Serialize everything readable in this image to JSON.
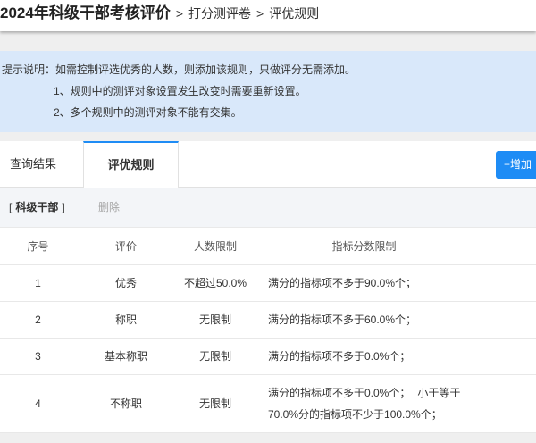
{
  "header": {
    "title": "2024年科级干部考核评价",
    "separator": ">",
    "breadcrumb": [
      "打分测评卷",
      "评优规则"
    ]
  },
  "notice": {
    "lines": [
      "提示说明：如需控制评选优秀的人数，则添加该规则，只做评分无需添加。",
      "1、规则中的测评对象设置发生改变时需要重新设置。",
      "2、多个规则中的测评对象不能有交集。"
    ]
  },
  "tabs": [
    {
      "label": "查询结果",
      "active": false
    },
    {
      "label": "评优规则",
      "active": true
    }
  ],
  "toolbar": {
    "add_label": "+增加"
  },
  "rule_group": {
    "open_bracket": "[",
    "name": "科级干部",
    "close_bracket": "]",
    "delete_label": "删除"
  },
  "table": {
    "columns": [
      "序号",
      "评价",
      "人数限制",
      "指标分数限制"
    ],
    "rows": [
      {
        "index": "1",
        "rating": "优秀",
        "count_limit": "不超过50.0%",
        "score_limits": [
          "满分的指标项不多于90.0%个；"
        ]
      },
      {
        "index": "2",
        "rating": "称职",
        "count_limit": "无限制",
        "score_limits": [
          "满分的指标项不多于60.0%个；"
        ]
      },
      {
        "index": "3",
        "rating": "基本称职",
        "count_limit": "无限制",
        "score_limits": [
          "满分的指标项不多于0.0%个；"
        ]
      },
      {
        "index": "4",
        "rating": "不称职",
        "count_limit": "无限制",
        "score_limits": [
          "满分的指标项不多于0.0%个；",
          "小于等于70.0%分的指标项不少于100.0%个；"
        ]
      }
    ]
  },
  "theme": {
    "accent": "#1e8cf5",
    "notice_bg": "#d9e8fa",
    "page_bg": "#efefef",
    "muted_text": "#a6a6a6"
  }
}
